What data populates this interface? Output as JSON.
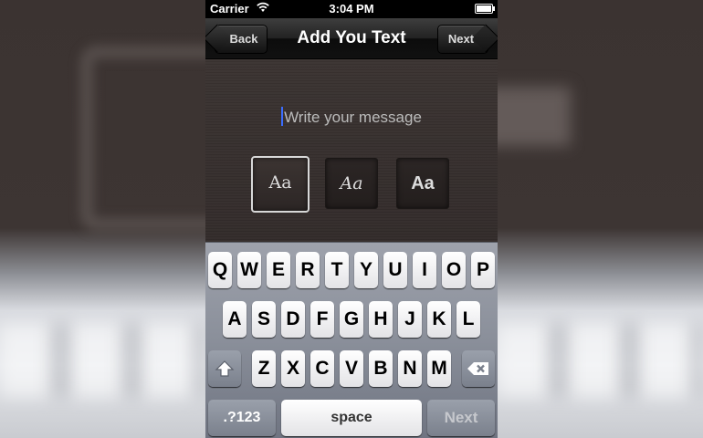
{
  "status_bar": {
    "carrier": "Carrier",
    "wifi_icon": "wifi-icon",
    "time": "3:04 PM",
    "battery_icon": "battery-icon"
  },
  "nav": {
    "back_label": "Back",
    "title": "Add You Text",
    "next_label": "Next"
  },
  "editor": {
    "placeholder": "Write your message",
    "font_options": [
      {
        "label": "Aa",
        "selected": true
      },
      {
        "label": "Aa",
        "selected": false
      },
      {
        "label": "Aa",
        "selected": false
      }
    ]
  },
  "keyboard": {
    "row1": [
      "Q",
      "W",
      "E",
      "R",
      "T",
      "Y",
      "U",
      "I",
      "O",
      "P"
    ],
    "row2": [
      "A",
      "S",
      "D",
      "F",
      "G",
      "H",
      "J",
      "K",
      "L"
    ],
    "row3": [
      "Z",
      "X",
      "C",
      "V",
      "B",
      "N",
      "M"
    ],
    "shift_icon": "shift-icon",
    "delete_icon": "delete-icon",
    "numbers_label": ".?123",
    "space_label": "space",
    "return_label": "Next"
  }
}
